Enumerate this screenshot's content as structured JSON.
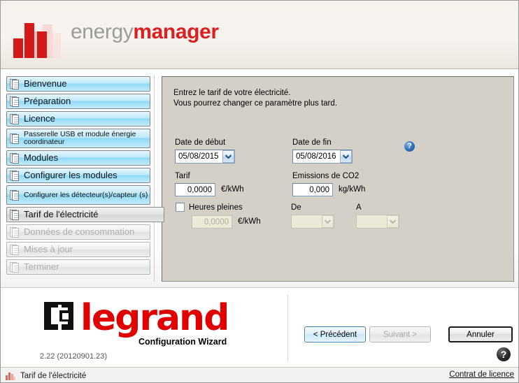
{
  "header": {
    "brand_primary": "energy",
    "brand_secondary": "manager",
    "logo_icon": "bar-chart-logo",
    "accent_color": "#dd1f1f"
  },
  "sidebar": {
    "items": [
      {
        "label": "Bienvenue",
        "state": "done",
        "icon": "page-icon"
      },
      {
        "label": "Préparation",
        "state": "done",
        "icon": "page-icon"
      },
      {
        "label": "Licence",
        "state": "done",
        "icon": "page-icon"
      },
      {
        "label": "Passerelle USB et module énergie coordinateur",
        "state": "done",
        "icon": "page-icon"
      },
      {
        "label": "Modules",
        "state": "done",
        "icon": "page-icon"
      },
      {
        "label": "Configurer les modules",
        "state": "done",
        "icon": "page-icon"
      },
      {
        "label": "Configurer les détecteur(s)/capteur (s)",
        "state": "done",
        "icon": "page-icon"
      },
      {
        "label": "Tarif de l'électricité",
        "state": "active",
        "icon": "page-icon"
      },
      {
        "label": "Données de consommation",
        "state": "disabled",
        "icon": "page-icon"
      },
      {
        "label": "Mises à jour",
        "state": "disabled",
        "icon": "page-icon"
      },
      {
        "label": "Terminer",
        "state": "disabled",
        "icon": "page-icon"
      }
    ]
  },
  "content": {
    "intro": "Entrez le tarif de votre électricité.\nVous pourrez changer ce paramètre plus tard.",
    "help_icon": "help-circle-icon",
    "help_glyph": "?",
    "start_date": {
      "label": "Date de début",
      "value": "05/08/2015"
    },
    "end_date": {
      "label": "Date de fin",
      "value": "05/08/2016"
    },
    "tariff": {
      "label": "Tarif",
      "value": "0,0000",
      "unit": "€/kWh"
    },
    "co2": {
      "label": "Emissions de CO2",
      "value": "0,000",
      "unit": "kg/kWh"
    },
    "peak_hours": {
      "label": "Heures pleines",
      "checked": false,
      "rate_value": "0,0000",
      "rate_unit": "€/kWh",
      "from_label": "De",
      "from_value": "",
      "to_label": "A",
      "to_value": ""
    }
  },
  "footer": {
    "brand": "legrand",
    "brand_mark_icon": "legrand-square-icon",
    "subtitle": "Configuration Wizard",
    "version": "2.22 (20120901.23)",
    "buttons": {
      "back": "< Précédent",
      "next": "Suivant >",
      "cancel": "Annuler"
    },
    "help_icon": "help-circle-dark-icon",
    "help_glyph": "?"
  },
  "statusbar": {
    "icon": "bar-chart-icon",
    "text": "Tarif de l'électricité",
    "licence_link": "Contrat de licence"
  }
}
